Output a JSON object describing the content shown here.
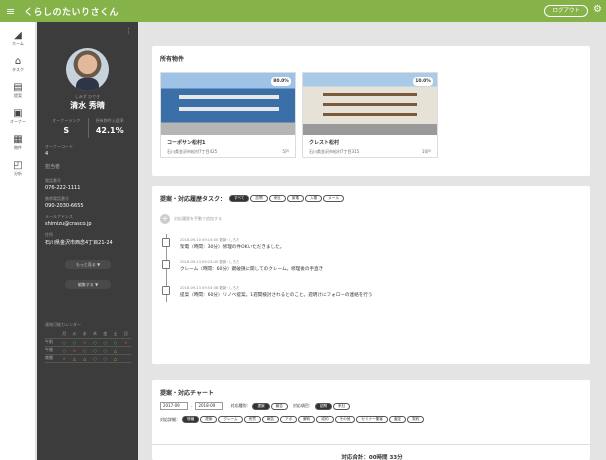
{
  "app": {
    "title": "くらしのたいりさくん",
    "logout_label": "ログアウト"
  },
  "rail": [
    {
      "icon": "home-icon",
      "glyph": "◢",
      "label": "ホーム"
    },
    {
      "icon": "task-icon",
      "glyph": "⌂",
      "label": "タスク"
    },
    {
      "icon": "report-icon",
      "glyph": "▤",
      "label": "提案"
    },
    {
      "icon": "owner-icon",
      "glyph": "▣",
      "label": "オーナー"
    },
    {
      "icon": "property-icon",
      "glyph": "▦",
      "label": "物件"
    },
    {
      "icon": "analysis-icon",
      "glyph": "◰",
      "label": "分析"
    }
  ],
  "profile": {
    "name_sub": "しみず ひでき",
    "name": "清水 秀晴",
    "rank_label": "オーナーランク",
    "rank_value": "S",
    "rate_label": "所有物件入居率",
    "rate_value": "42.1%",
    "owner_code_label": "オーナーコード",
    "owner_code": "4",
    "flag": "担当者",
    "phone_label": "電話番号",
    "phone": "076-222-1111",
    "mobile_label": "携帯電話番号",
    "mobile": "090-2030-6655",
    "email_label": "メールアドレス",
    "email": "shimizu@crasco.jp",
    "address_label": "住所",
    "address": "石川県金沢市西念4丁目21-24",
    "more_label": "もっと見る ▼",
    "edit_label": "編集する ▼",
    "calendar_title": "連絡可能カレンダー",
    "calendar_days": [
      "月",
      "火",
      "水",
      "木",
      "金",
      "土",
      "日"
    ],
    "calendar_rows": [
      {
        "label": "午前",
        "marks": [
          "○",
          "○",
          "×",
          "○",
          "○",
          "○",
          "×"
        ]
      },
      {
        "label": "午後",
        "marks": [
          "○",
          "×",
          "○",
          "○",
          "○",
          "△",
          ""
        ]
      },
      {
        "label": "夜間",
        "marks": [
          "×",
          "△",
          "△",
          "○",
          "○",
          "△",
          ""
        ]
      }
    ]
  },
  "properties": {
    "title": "所有物件",
    "items": [
      {
        "name": "コーポサン松村1",
        "address": "石川県金沢市松村7丁目425",
        "units": "5戸",
        "rate": "80.0%"
      },
      {
        "name": "クレスト松村",
        "address": "石川県金沢市松村7丁目315",
        "units": "10戸",
        "rate": "10.0%"
      }
    ]
  },
  "tasks": {
    "title": "提案・対応履歴タスク：",
    "filters": [
      {
        "label": "すべて",
        "active": true
      },
      {
        "label": "訪問",
        "active": false
      },
      {
        "label": "来社",
        "active": false
      },
      {
        "label": "架電",
        "active": false
      },
      {
        "label": "入電",
        "active": false
      },
      {
        "label": "メール",
        "active": false
      }
    ],
    "add_label": "対応履歴を手動で追加する",
    "history": [
      {
        "meta": "2018-09-10 09:14:00 更新: しろた",
        "text": "架電（時間：30分）修理の件OKいただきました。"
      },
      {
        "meta": "2018-09-13 09:23:45 更新: しろた",
        "text": "クレーム（時間：60分）鍵破損に関してのクレーム。修理後の手直き"
      },
      {
        "meta": "2018-09-13 09:53:48 更新: しろた",
        "text": "提案（時間：60分）リノベ提案。1週間検討されるとのこと。週明けにフォローの連絡を行う"
      }
    ]
  },
  "chart": {
    "title": "提案・対応チャート",
    "date_from": "2017-09",
    "date_to": "2018-09",
    "type_label": "対応種別：",
    "type_options": [
      {
        "label": "提案",
        "active": true
      },
      {
        "label": "報告",
        "active": false
      }
    ],
    "item_label": "対応項目：",
    "item_options": [
      {
        "label": "訪問",
        "active": true
      },
      {
        "label": "来社",
        "active": false
      }
    ],
    "detail_label": "対応詳細：",
    "detail_options": [
      {
        "label": "修繕",
        "active": true
      },
      {
        "label": "提案",
        "active": false
      },
      {
        "label": "クレーム",
        "active": false
      },
      {
        "label": "売買",
        "active": false
      },
      {
        "label": "報告",
        "active": false
      },
      {
        "label": "アポ",
        "active": false
      },
      {
        "label": "解約",
        "active": false
      },
      {
        "label": "成約",
        "active": false
      },
      {
        "label": "その他",
        "active": false
      },
      {
        "label": "セミナー集客",
        "active": false
      },
      {
        "label": "査定",
        "active": false
      },
      {
        "label": "契約",
        "active": false
      }
    ],
    "total_label": "対応合計：00時間 33分"
  }
}
